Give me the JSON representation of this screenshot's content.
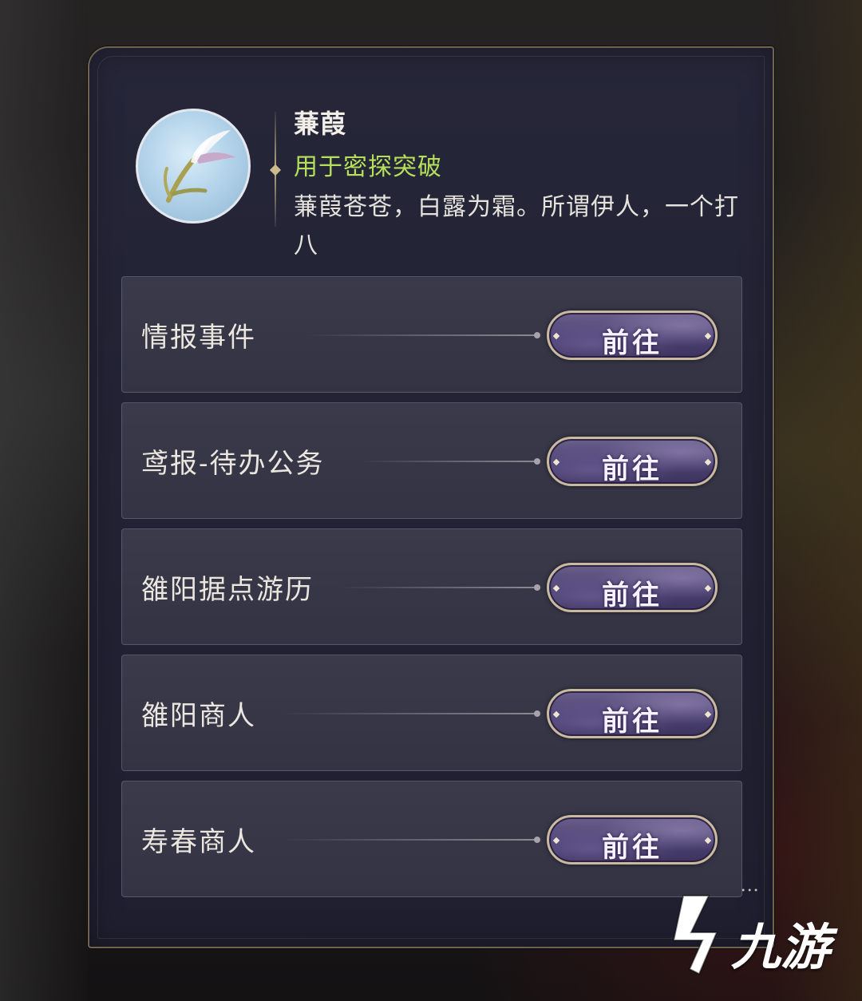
{
  "item": {
    "name": "蒹葭",
    "usage": "用于密探突破",
    "description": "蒹葭苍苍，白露为霜。所谓伊人，一个打八",
    "icon": "reed-plume-icon"
  },
  "sources": [
    {
      "label": "情报事件",
      "button": "前往"
    },
    {
      "label": "鸢报-待办公务",
      "button": "前往"
    },
    {
      "label": "雒阳据点游历",
      "button": "前往"
    },
    {
      "label": "雒阳商人",
      "button": "前往"
    },
    {
      "label": "寿春商人",
      "button": "前往"
    }
  ],
  "watermark": {
    "text": "九游",
    "icon": "jiuyou-logo-icon"
  },
  "colors": {
    "usage_text": "#b6e05a",
    "panel_border": "#6e6450",
    "button": "#4a4170"
  }
}
